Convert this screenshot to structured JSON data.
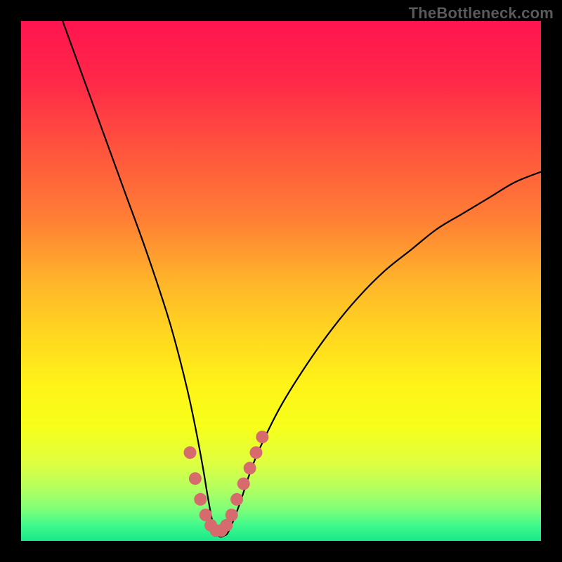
{
  "watermark": "TheBottleneck.com",
  "chart_data": {
    "type": "line",
    "title": "",
    "xlabel": "",
    "ylabel": "",
    "xlim": [
      0,
      100
    ],
    "ylim": [
      0,
      100
    ],
    "grid": false,
    "legend": false,
    "series": [
      {
        "name": "curve",
        "color": "#000000",
        "x": [
          8,
          12,
          16,
          20,
          24,
          28,
          30,
          32,
          33.5,
          35,
          36,
          37,
          38,
          39,
          40,
          42,
          44,
          46,
          50,
          55,
          60,
          65,
          70,
          75,
          80,
          85,
          90,
          95,
          100
        ],
        "y": [
          100,
          89,
          78,
          67,
          56,
          44,
          37,
          29,
          22,
          14,
          8,
          3,
          1,
          1,
          2,
          7,
          13,
          18,
          26,
          34,
          41,
          47,
          52,
          56,
          60,
          63,
          66,
          69,
          71
        ]
      },
      {
        "name": "bottom-marker",
        "color": "#d66a6d",
        "x": [
          32.5,
          33.5,
          34.5,
          35.5,
          36.5,
          37.5,
          38.5,
          39.5,
          40.5,
          41.5,
          42.8,
          44.0,
          45.2,
          46.4
        ],
        "y": [
          17,
          12,
          8,
          5,
          3,
          2,
          2,
          3,
          5,
          8,
          11,
          14,
          17,
          20
        ]
      }
    ],
    "gradient_stops": [
      {
        "offset": 0.0,
        "color": "#ff1450"
      },
      {
        "offset": 0.12,
        "color": "#ff2a48"
      },
      {
        "offset": 0.25,
        "color": "#ff553d"
      },
      {
        "offset": 0.38,
        "color": "#ff7e35"
      },
      {
        "offset": 0.5,
        "color": "#ffb42a"
      },
      {
        "offset": 0.6,
        "color": "#ffd620"
      },
      {
        "offset": 0.7,
        "color": "#fff318"
      },
      {
        "offset": 0.78,
        "color": "#f7ff1a"
      },
      {
        "offset": 0.85,
        "color": "#deff40"
      },
      {
        "offset": 0.9,
        "color": "#b3ff60"
      },
      {
        "offset": 0.94,
        "color": "#7dff7a"
      },
      {
        "offset": 0.97,
        "color": "#40f98c"
      },
      {
        "offset": 1.0,
        "color": "#18e88a"
      }
    ]
  }
}
